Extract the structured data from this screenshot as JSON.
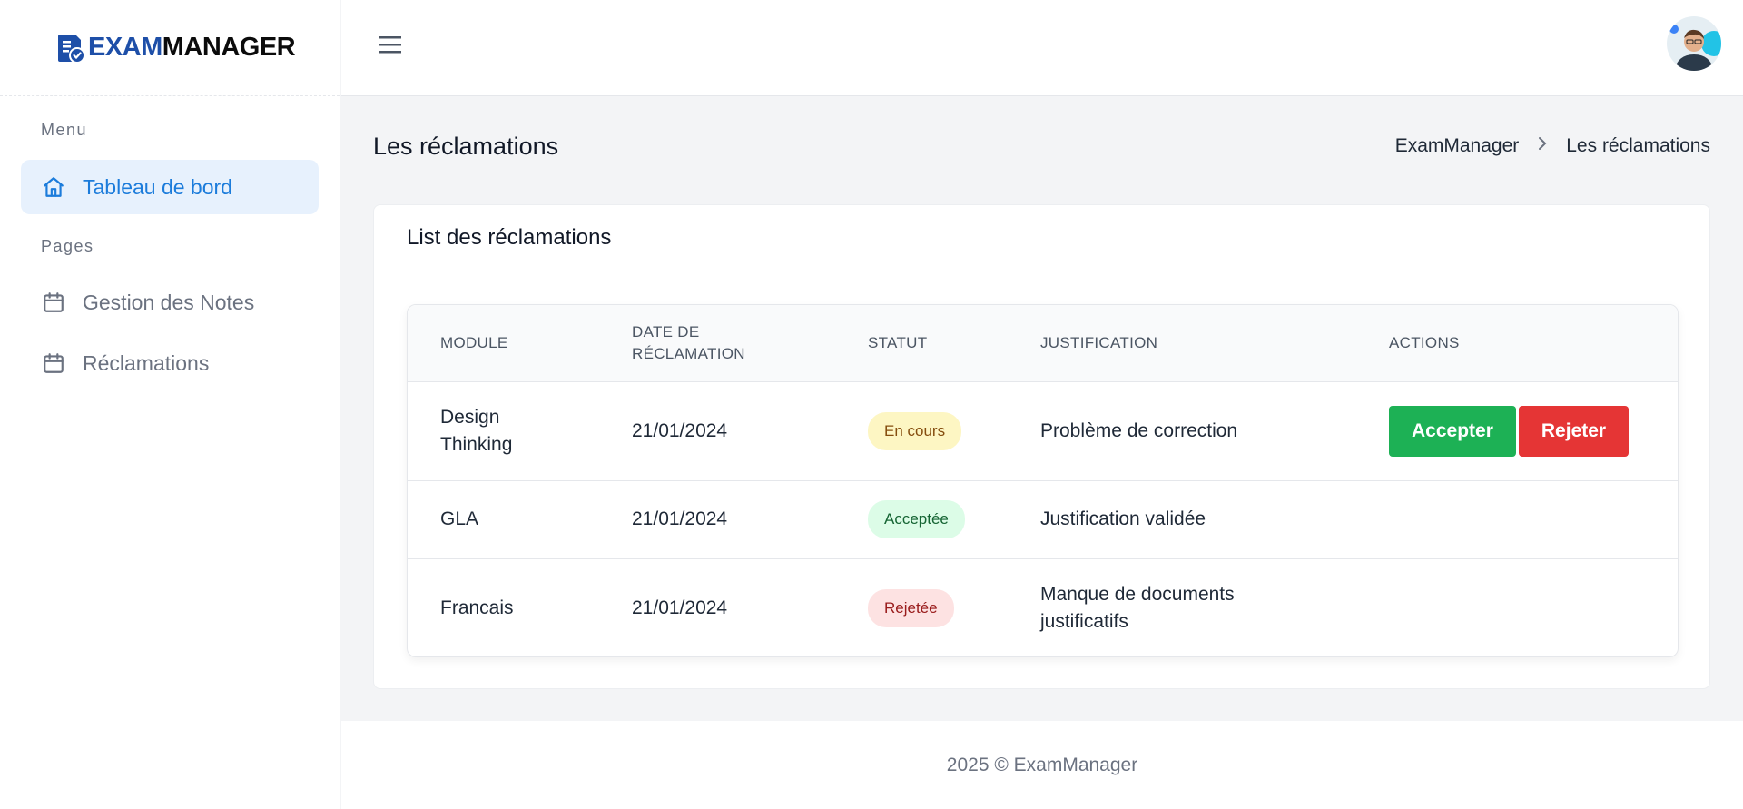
{
  "brand": {
    "part1": "EXAM",
    "part2": "MANAGER",
    "color_primary": "#1e4fa8"
  },
  "sidebar": {
    "menu_heading": "Menu",
    "pages_heading": "Pages",
    "items": [
      {
        "label": "Tableau de bord",
        "icon": "home-icon",
        "active": true
      },
      {
        "label": "Gestion des Notes",
        "icon": "calendar-icon",
        "active": false
      },
      {
        "label": "Réclamations",
        "icon": "calendar-icon",
        "active": false
      }
    ]
  },
  "header": {
    "menu_icon": "hamburger-icon",
    "avatar": "user-avatar"
  },
  "page": {
    "title": "Les réclamations",
    "breadcrumb": [
      "ExamManager",
      "Les réclamations"
    ]
  },
  "card": {
    "title": "List des réclamations",
    "columns": [
      "Module",
      "Date de réclamation",
      "Statut",
      "Justification",
      "Actions"
    ],
    "rows": [
      {
        "module": "Design Thinking",
        "date": "21/01/2024",
        "status": "En cours",
        "status_bg": "#fdf6c3",
        "status_color": "#854d0e",
        "justification": "Problème de correction",
        "actions": [
          "Accepter",
          "Rejeter"
        ]
      },
      {
        "module": "GLA",
        "date": "21/01/2024",
        "status": "Acceptée",
        "status_bg": "#dcfce7",
        "status_color": "#166534",
        "justification": "Justification validée",
        "actions": []
      },
      {
        "module": "Francais",
        "date": "21/01/2024",
        "status": "Rejetée",
        "status_bg": "#fde2e2",
        "status_color": "#991b1b",
        "justification": "Manque de documents justificatifs",
        "actions": []
      }
    ]
  },
  "footer": {
    "text": "2025 © ExamManager"
  }
}
